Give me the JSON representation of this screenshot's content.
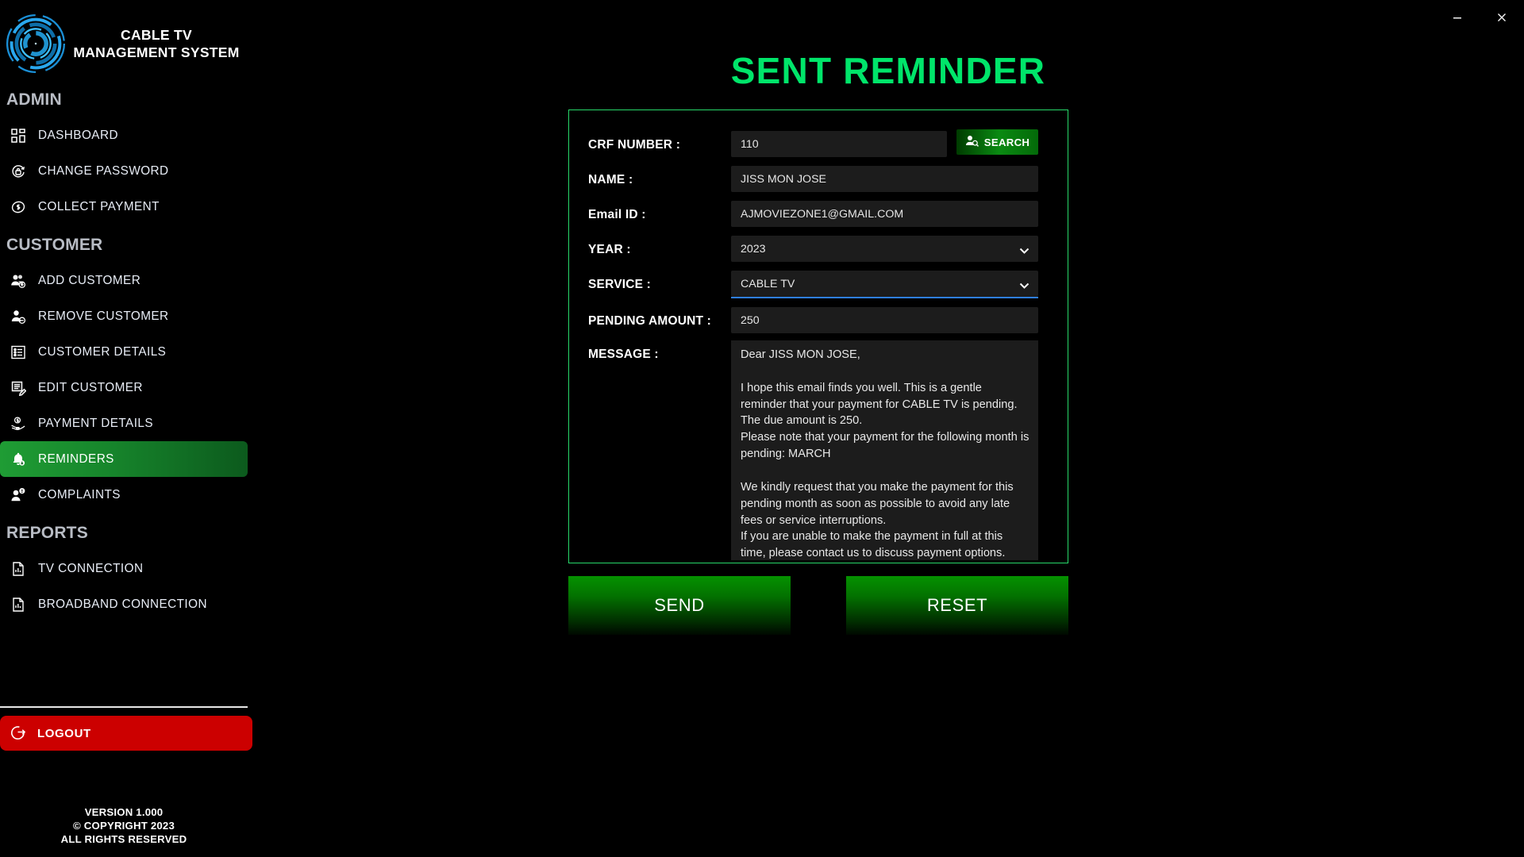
{
  "window": {
    "minimize_label": "minimize-icon",
    "close_label": "close-icon"
  },
  "brand": {
    "title": "CABLE TV MANAGEMENT SYSTEM",
    "logo_icon": "circular-tech-logo"
  },
  "sidebar": {
    "sections": [
      {
        "heading": "ADMIN",
        "items": [
          {
            "label": "DASHBOARD",
            "icon": "dashboard-icon",
            "active": false
          },
          {
            "label": "CHANGE PASSWORD",
            "icon": "password-reset-icon",
            "active": false
          },
          {
            "label": "COLLECT PAYMENT",
            "icon": "money-icon",
            "active": false
          }
        ]
      },
      {
        "heading": "CUSTOMER",
        "items": [
          {
            "label": "ADD CUSTOMER",
            "icon": "user-add-icon",
            "active": false
          },
          {
            "label": "REMOVE CUSTOMER",
            "icon": "user-remove-icon",
            "active": false
          },
          {
            "label": "CUSTOMER DETAILS",
            "icon": "list-details-icon",
            "active": false
          },
          {
            "label": "EDIT CUSTOMER",
            "icon": "edit-document-icon",
            "active": false
          },
          {
            "label": "PAYMENT DETAILS",
            "icon": "hand-money-icon",
            "active": false
          },
          {
            "label": "REMINDERS",
            "icon": "bell-icon",
            "active": true
          },
          {
            "label": "COMPLAINTS",
            "icon": "user-alert-icon",
            "active": false
          }
        ]
      },
      {
        "heading": "REPORTS",
        "items": [
          {
            "label": "TV CONNECTION",
            "icon": "report-chart-icon",
            "active": false
          },
          {
            "label": "BROADBAND CONNECTION",
            "icon": "report-chart-icon",
            "active": false
          }
        ]
      }
    ],
    "logout": {
      "label": "LOGOUT",
      "icon": "logout-icon"
    },
    "footer": {
      "version": "VERSION 1.000",
      "copyright": "© COPYRIGHT 2023",
      "rights": "ALL RIGHTS RESERVED"
    }
  },
  "main": {
    "page_title": "SENT REMINDER",
    "form": {
      "crf_number": {
        "label": "CRF NUMBER :",
        "value": "110",
        "placeholder": ""
      },
      "search_button": {
        "label": "SEARCH",
        "icon": "user-search-icon"
      },
      "name": {
        "label": "NAME :",
        "value": "JISS MON JOSE",
        "placeholder": ""
      },
      "email": {
        "label": "Email ID :",
        "value": "AJMOVIEZONE1@GMAIL.COM",
        "placeholder": ""
      },
      "year": {
        "label": "YEAR :",
        "value": "2023",
        "options": [
          "2023"
        ]
      },
      "service": {
        "label": "SERVICE :",
        "value": "CABLE TV",
        "options": [
          "CABLE TV"
        ],
        "focused": true
      },
      "pending_amount": {
        "label": "PENDING AMOUNT :",
        "value": "250",
        "placeholder": ""
      },
      "message": {
        "label": "MESSAGE :",
        "value": "Dear JISS MON JOSE,\n\nI hope this email finds you well. This is a gentle reminder that your payment for CABLE TV is pending. The due amount is 250.\nPlease note that your payment for the following month is pending: MARCH\n\nWe kindly request that you make the payment for this pending month as soon as possible to avoid any late fees or service interruptions.\nIf you are unable to make the payment in full at this time, please contact us to discuss payment options."
      }
    },
    "actions": {
      "send_label": "SEND",
      "reset_label": "RESET"
    }
  },
  "colors": {
    "accent_green": "#00e56a",
    "panel_border": "#28d96a",
    "active_nav": "#1f9c34",
    "logout_red": "#cc0000",
    "focus_blue": "#2f7fe8",
    "field_bg": "#1c1c1c"
  }
}
